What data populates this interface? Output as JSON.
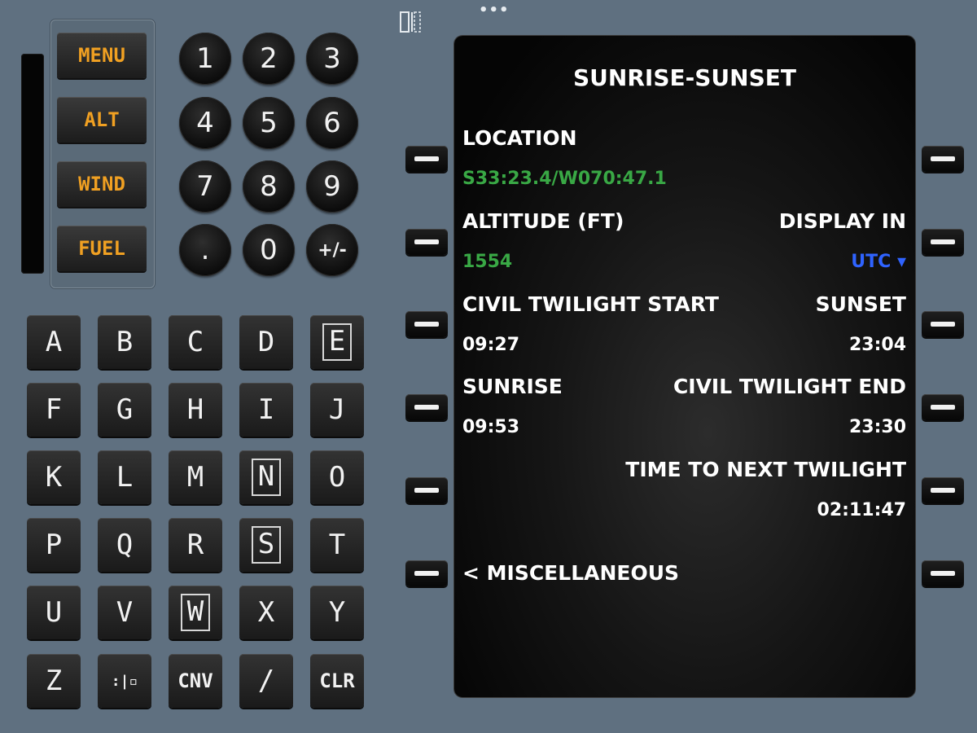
{
  "top": {
    "dots": "•••"
  },
  "function_keys": [
    "MENU",
    "ALT",
    "WIND",
    "FUEL"
  ],
  "numpad": [
    "1",
    "2",
    "3",
    "4",
    "5",
    "6",
    "7",
    "8",
    "9",
    ".",
    "0",
    "+/-"
  ],
  "alpha_keys": [
    "A",
    "B",
    "C",
    "D",
    "E",
    "F",
    "G",
    "H",
    "I",
    "J",
    "K",
    "L",
    "M",
    "N",
    "O",
    "P",
    "Q",
    "R",
    "S",
    "T",
    "U",
    "V",
    "W",
    "X",
    "Y",
    "Z",
    ":|▫",
    "CNV",
    "/",
    "CLR"
  ],
  "outlined_keys": [
    "E",
    "N",
    "S",
    "W"
  ],
  "screen": {
    "title": "SUNRISE-SUNSET",
    "location_label": "LOCATION",
    "location_value": "S33:23.4/W070:47.1",
    "altitude_label": "ALTITUDE (FT)",
    "altitude_value": "1554",
    "display_in_label": "DISPLAY IN",
    "display_in_value": "UTC ▾",
    "civil_twilight_start_label": "CIVIL TWILIGHT START",
    "civil_twilight_start_value": "09:27",
    "sunset_label": "SUNSET",
    "sunset_value": "23:04",
    "sunrise_label": "SUNRISE",
    "sunrise_value": "09:53",
    "civil_twilight_end_label": "CIVIL TWILIGHT END",
    "civil_twilight_end_value": "23:30",
    "time_to_next_twilight_label": "TIME TO NEXT TWILIGHT",
    "time_to_next_twilight_value": "02:11:47",
    "misc_link": "< MISCELLANEOUS"
  },
  "colors": {
    "green": "#39a845",
    "blue": "#2f63ff",
    "amber": "#f0a022"
  }
}
